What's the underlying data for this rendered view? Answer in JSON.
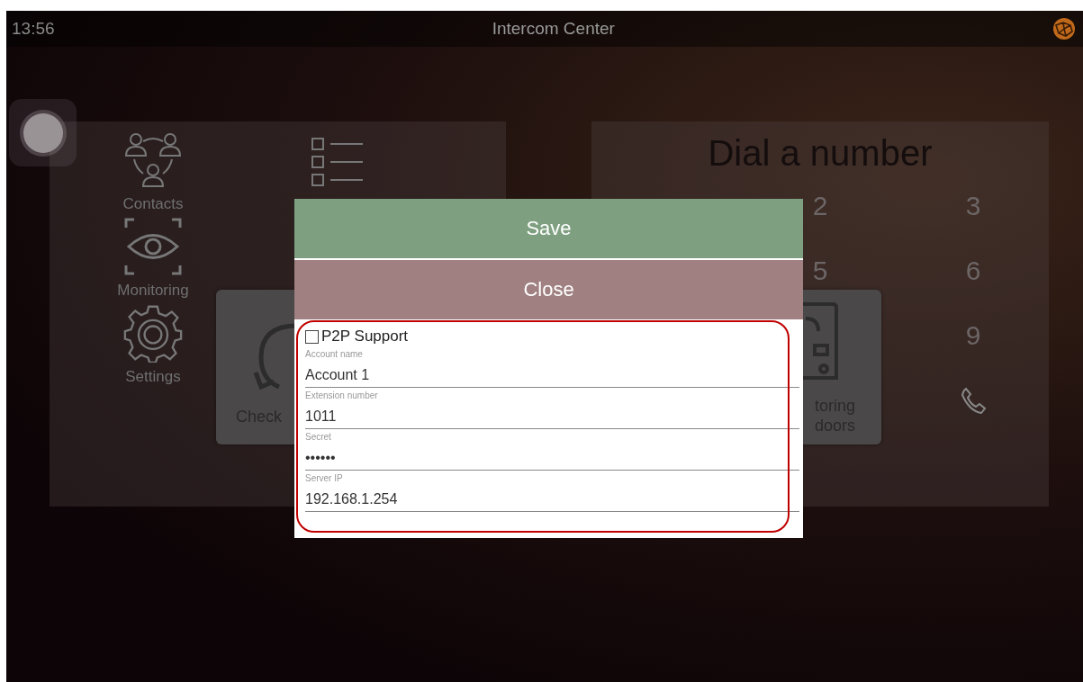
{
  "status_bar": {
    "time": "13:56",
    "title": "Intercom Center"
  },
  "menu": [
    {
      "label": "Contacts",
      "kind": "contacts"
    },
    {
      "label": "Monitoring",
      "kind": "monitoring"
    },
    {
      "label": "Settings",
      "kind": "settings"
    }
  ],
  "cards": [
    {
      "kind": "check",
      "lines": [
        "Check"
      ]
    },
    {
      "kind": "doors",
      "lines": [
        "toring",
        "doors"
      ]
    }
  ],
  "dialpad": {
    "title": "Dial a number",
    "rows": [
      {
        "keys": [
          "2",
          "3"
        ]
      },
      {
        "keys": [
          "5",
          "6"
        ]
      },
      {
        "keys": [
          "9"
        ]
      }
    ]
  },
  "dialog": {
    "buttons": [
      {
        "label": "Save",
        "kind": "save"
      },
      {
        "label": "Close",
        "kind": "close"
      }
    ],
    "checkbox": {
      "label": "P2P Support",
      "checked": false
    },
    "fields": [
      {
        "label": "Account name",
        "value": "Account 1"
      },
      {
        "label": "Extension number",
        "value": "1011"
      },
      {
        "label": "Secret",
        "value": "••••••"
      },
      {
        "label": "Server IP",
        "value": "192.168.1.254"
      }
    ]
  }
}
